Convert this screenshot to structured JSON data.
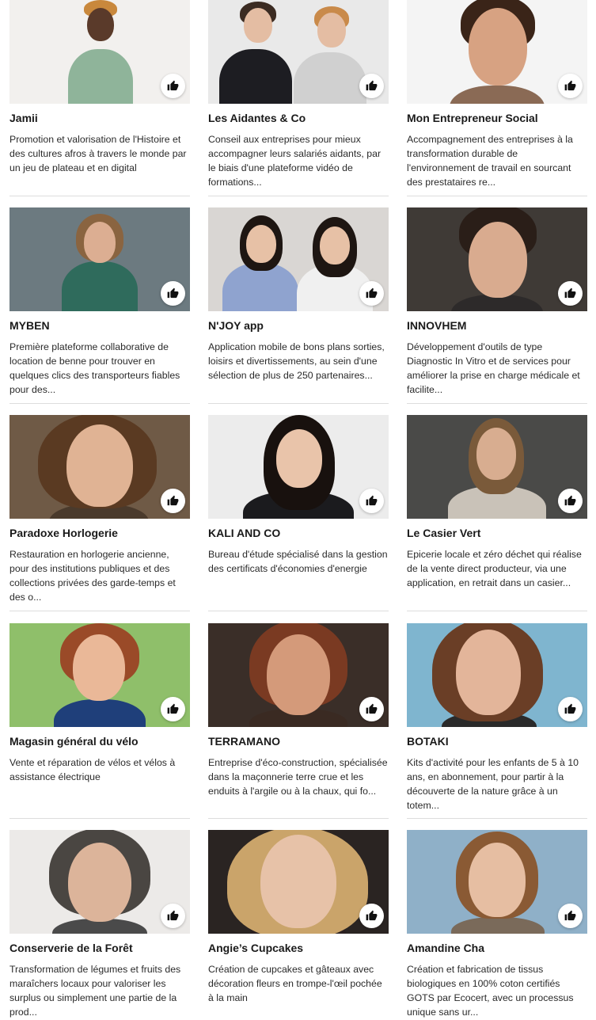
{
  "like_icon": "thumbs-up-icon",
  "cards": [
    {
      "name": "Jamii",
      "desc": "Promotion et valorisation de l'Histoire et des cultures afros à travers le monde par un jeu de plateau et en digital",
      "bg": "#f2f0ee",
      "skin": "#5a3a2a",
      "hair": "#c9883c",
      "top": "#8fb49a"
    },
    {
      "name": "Les Aidantes & Co",
      "desc": "Conseil aux entreprises pour mieux accompagner leurs salariés aidants, par le biais d'une plateforme vidéo de formations...",
      "bg": "#e9e9e9",
      "skin": "#e4bda3",
      "hair": "#3b2b22",
      "top": "#1d1d22"
    },
    {
      "name": "Mon Entrepreneur Social",
      "desc": "Accompagnement des entreprises à la transformation durable de l'environnement de travail en sourcant des prestataires re...",
      "bg": "#f4f4f4",
      "skin": "#d7a282",
      "hair": "#3a2418",
      "top": "#8a6a55"
    },
    {
      "name": "MYBEN",
      "desc": "Première plateforme collaborative de location de benne pour trouver en quelques clics des transporteurs fiables pour des...",
      "bg": "#6c7a80",
      "skin": "#dcae92",
      "hair": "#8a6440",
      "top": "#2f6b5c"
    },
    {
      "name": "N'JOY app",
      "desc": "Application mobile de bons plans sorties, loisirs et divertissements, au sein d'une sélection de plus de 250 partenaires...",
      "bg": "#d9d6d3",
      "skin": "#e7c1a6",
      "hair": "#1e1612",
      "top": "#8fa3cf"
    },
    {
      "name": "INNOVHEM",
      "desc": "Développement d'outils de type Diagnostic In Vitro et de services pour améliorer la prise en charge médicale et facilite...",
      "bg": "#3f3a36",
      "skin": "#d9ab8f",
      "hair": "#2a1e18",
      "top": "#2d2a2a"
    },
    {
      "name": "Paradoxe Horlogerie",
      "desc": "Restauration en horlogerie ancienne, pour des institutions publiques et des collections privées des garde-temps et des o...",
      "bg": "#6f5a46",
      "skin": "#e0b394",
      "hair": "#5a3a22",
      "top": "#4a3a2c"
    },
    {
      "name": "KALI AND CO",
      "desc": "Bureau d'étude spécialisé dans la gestion des certificats d'économies d'energie",
      "bg": "#ececec",
      "skin": "#e9c4aa",
      "hair": "#18110e",
      "top": "#1b1b1e"
    },
    {
      "name": "Le Casier Vert",
      "desc": "Epicerie locale et zéro déchet qui réalise de la vente direct producteur, via une application, en retrait dans un casier...",
      "bg": "#4a4a48",
      "skin": "#d8ad90",
      "hair": "#7a5a3a",
      "top": "#c9c2b8"
    },
    {
      "name": "Magasin général du vélo",
      "desc": "Vente et réparation de vélos et vélos à assistance électrique",
      "bg": "#8fbf6a",
      "skin": "#eab898",
      "hair": "#9a4a28",
      "top": "#1f3f7a"
    },
    {
      "name": "TERRAMANO",
      "desc": "Entreprise d'éco-construction, spécialisée dans la maçonnerie terre crue et les enduits à l'argile ou à la chaux, qui fo...",
      "bg": "#3a2e28",
      "skin": "#d49a7a",
      "hair": "#7a3a22",
      "top": "#3a2a22"
    },
    {
      "name": "BOTAKI",
      "desc": "Kits d'activité pour les enfants de 5 à 10 ans, en abonnement, pour partir à la découverte de la nature grâce à un totem...",
      "bg": "#7fb5cf",
      "skin": "#e3b59a",
      "hair": "#6a3e26",
      "top": "#2a2a2a"
    },
    {
      "name": "Conserverie de la Forêt",
      "desc": "Transformation de légumes et fruits des maraîchers locaux pour valoriser les surplus ou simplement une partie de la prod...",
      "bg": "#eceae8",
      "skin": "#dcb49a",
      "hair": "#4a4642",
      "top": "#4a4a4a"
    },
    {
      "name": "Angie’s Cupcakes",
      "desc": "Création de cupcakes et gâteaux avec décoration fleurs en trompe-l'œil pochée à la main",
      "bg": "#2a2422",
      "skin": "#e7c2a8",
      "hair": "#caa46a",
      "top": "#2a2020"
    },
    {
      "name": "Amandine Cha",
      "desc": "Création et fabrication de tissus biologiques en 100% coton certifiés GOTS par Ecocert, avec un processus unique sans ur...",
      "bg": "#8fb0c8",
      "skin": "#e6bea2",
      "hair": "#8a5a34",
      "top": "#7a6a5a"
    }
  ]
}
